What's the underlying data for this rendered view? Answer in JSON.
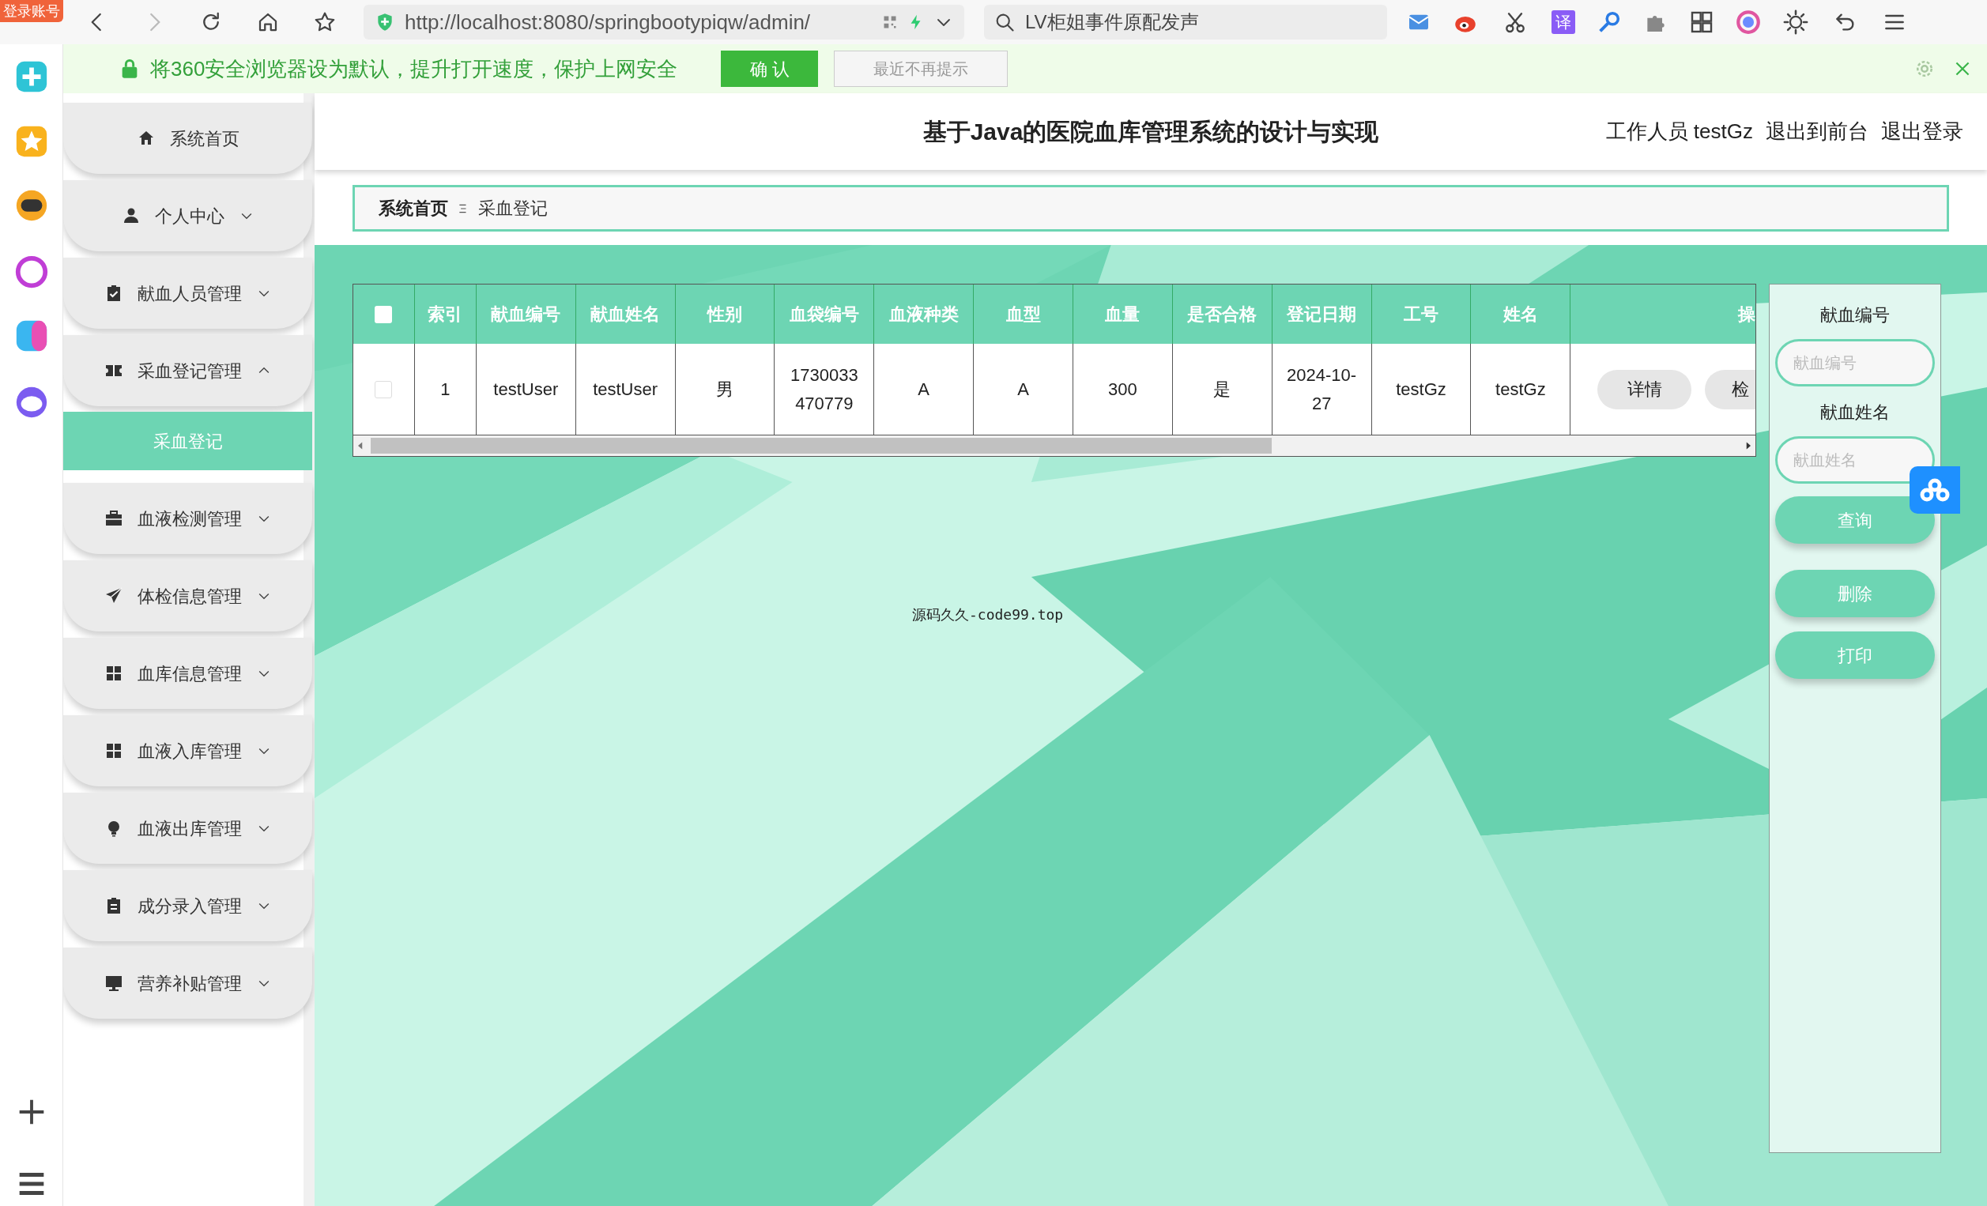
{
  "browser": {
    "account_badge": "登录账号",
    "url": "http://localhost:8080/springbootypiqw/admin/",
    "search": "LV柜姐事件原配发声",
    "translate": "译"
  },
  "notification": {
    "message": "将360安全浏览器设为默认，提升打开速度，保护上网安全",
    "confirm": "确 认",
    "dismiss": "最近不再提示"
  },
  "sidebar": {
    "items": [
      {
        "label": "系统首页",
        "kind": "link"
      },
      {
        "label": "个人中心",
        "kind": "menu",
        "expanded": false
      },
      {
        "label": "献血人员管理",
        "kind": "menu",
        "expanded": false
      },
      {
        "label": "采血登记管理",
        "kind": "menu",
        "expanded": true,
        "children": [
          {
            "label": "采血登记",
            "selected": true
          }
        ]
      },
      {
        "label": "血液检测管理",
        "kind": "menu",
        "expanded": false
      },
      {
        "label": "体检信息管理",
        "kind": "menu",
        "expanded": false
      },
      {
        "label": "血库信息管理",
        "kind": "menu",
        "expanded": false
      },
      {
        "label": "血液入库管理",
        "kind": "menu",
        "expanded": false
      },
      {
        "label": "血液出库管理",
        "kind": "menu",
        "expanded": false
      },
      {
        "label": "成分录入管理",
        "kind": "menu",
        "expanded": false
      },
      {
        "label": "营养补贴管理",
        "kind": "menu",
        "expanded": false
      }
    ]
  },
  "header": {
    "title": "基于Java的医院血库管理系统的设计与实现",
    "user": "工作人员 testGz",
    "links": [
      "退出到前台",
      "退出登录"
    ]
  },
  "breadcrumb": [
    "系统首页",
    "采血登记"
  ],
  "table": {
    "header_checked": false,
    "columns": [
      "索引",
      "献血编号",
      "献血姓名",
      "性别",
      "血袋编号",
      "血液种类",
      "血型",
      "血量",
      "是否合格",
      "登记日期",
      "工号",
      "姓名",
      "操"
    ],
    "rows": [
      {
        "checked": false,
        "cells": [
          "1",
          "testUser",
          "testUser",
          "男",
          "1730033470779",
          "A",
          "A",
          "300",
          "是",
          "2024-10-27",
          "testGz",
          "testGz"
        ],
        "actions": [
          "详情",
          "检"
        ]
      }
    ]
  },
  "search_panel": {
    "fields": [
      {
        "label": "献血编号",
        "placeholder": "献血编号"
      },
      {
        "label": "献血姓名",
        "placeholder": "献血姓名"
      }
    ],
    "buttons": [
      "查询",
      "删除",
      "打印"
    ]
  },
  "footer": "源码久久-code99.top"
}
